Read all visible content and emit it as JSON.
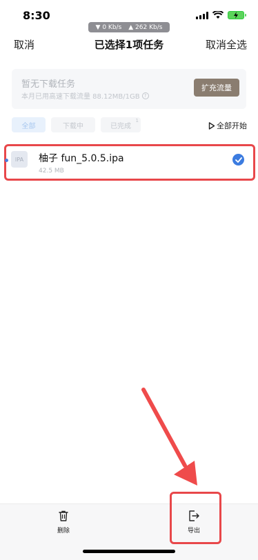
{
  "status_bar": {
    "time": "8:30",
    "download_speed": "▼ 0 Kb/s",
    "upload_speed": "▲ 262 Kb/s"
  },
  "nav": {
    "cancel": "取消",
    "title": "已选择1项任务",
    "deselect_all": "取消全选"
  },
  "banner": {
    "title": "暂无下载任务",
    "subtitle": "本月已用高速下载流量 88.12MB/1GB",
    "expand_button": "扩充流量"
  },
  "tabs": [
    {
      "label": "全部"
    },
    {
      "label": "下载中"
    },
    {
      "label": "已完成",
      "badge": "1"
    }
  ],
  "start_all": "全部开始",
  "item": {
    "icon_text": "IPA",
    "name": "柚子 fun_5.0.5.ipa",
    "size": "42.5 MB"
  },
  "bottom_bar": {
    "delete": "删除",
    "export": "导出"
  },
  "colors": {
    "accent": "#3c7ce0",
    "annotation": "#e8474a",
    "expand_button_bg": "#8a7d70"
  }
}
